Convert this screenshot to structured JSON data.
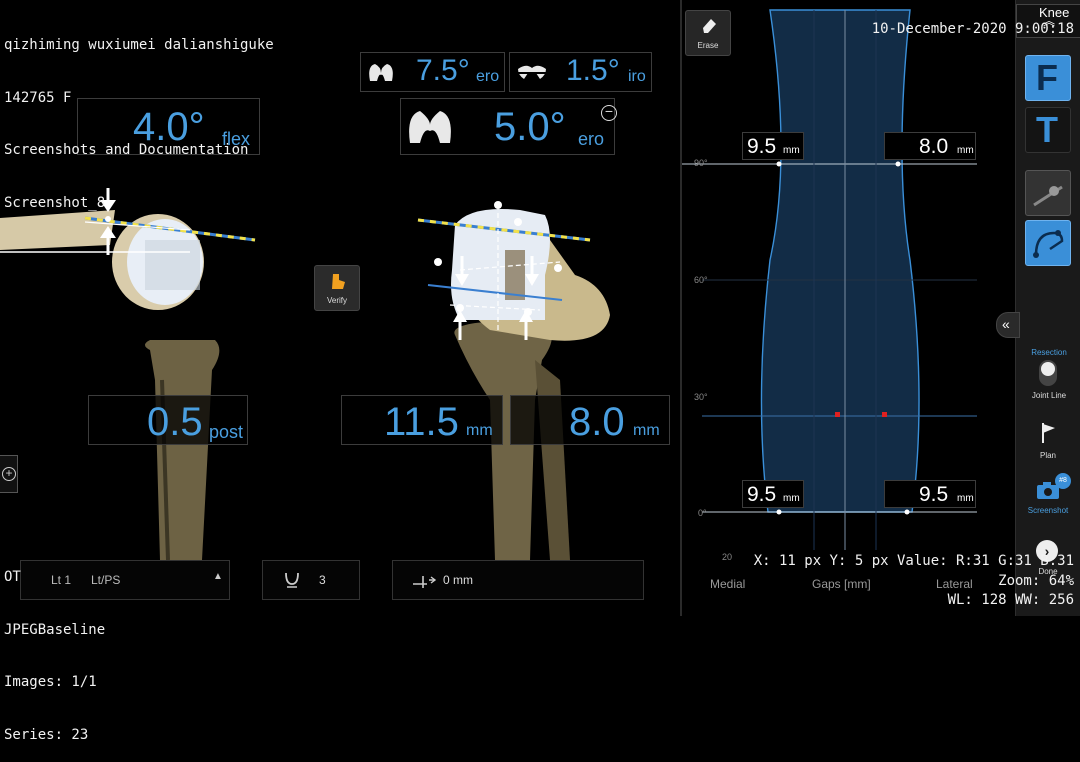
{
  "patient": {
    "name": "qizhiming wuxiumei dalianshiguke",
    "id_sex": "142765 F",
    "study": "Screenshots and Documentation",
    "screenshot": "Screenshot_8"
  },
  "header": {
    "date_time": "10-December-2020 9:00:18",
    "section": "Knee"
  },
  "left_view": {
    "flex_value": "4.0°",
    "flex_unit": "flex",
    "post_value": "0.5",
    "post_unit": "post"
  },
  "middle_view": {
    "varus_value": "7.5°",
    "varus_unit": "ero",
    "rot_value": "1.5°",
    "rot_unit": "iro",
    "femur_value": "5.0°",
    "femur_unit": "ero",
    "gap_left_value": "11.5",
    "gap_left_unit": "mm",
    "gap_right_value": "8.0",
    "gap_right_unit": "mm",
    "verify_label": "Verify"
  },
  "gap_chart": {
    "erase_label": "Erase",
    "y_ticks": [
      "90°",
      "60°",
      "30°",
      "0°"
    ],
    "x_tick_left": "20",
    "x_label_medial": "Medial",
    "x_label_gaps": "Gaps [mm]",
    "x_label_lateral": "Lateral",
    "gap_top_left_value": "9.5",
    "gap_top_left_unit": "mm",
    "gap_top_right_value": "8.0",
    "gap_top_right_unit": "mm",
    "gap_bottom_left_value": "9.5",
    "gap_bottom_left_unit": "mm",
    "gap_bottom_right_value": "9.5",
    "gap_bottom_right_unit": "mm"
  },
  "sidebar": {
    "femur_label": "F",
    "tibia_label": "T",
    "resection_label": "Resection",
    "joint_line_label": "Joint Line",
    "plan_label": "Plan",
    "screenshot_label": "Screenshot",
    "screenshot_badge": "#8",
    "done_label": "Done"
  },
  "bottom_bar": {
    "implant_label": "Lt/PS",
    "implant_prefix": "Lt 1 ",
    "insert_value": "3",
    "shift_value": "0 mm"
  },
  "dicom_overlay": {
    "line1": "OT",
    "line2": "JPEGBaseline",
    "line3": "Images: 1/1",
    "line4": "Series: 23",
    "pixel_info": "X: 11 px Y: 5 px Value: R:31 G:31 B:31",
    "zoom": "Zoom: 64%",
    "window": "WL: 128 WW: 256"
  },
  "colors": {
    "accent_blue": "#4a9fe0",
    "active_button": "#3a8fd8",
    "yellow_line": "#f2e14a",
    "bone": "#c8b48a"
  }
}
